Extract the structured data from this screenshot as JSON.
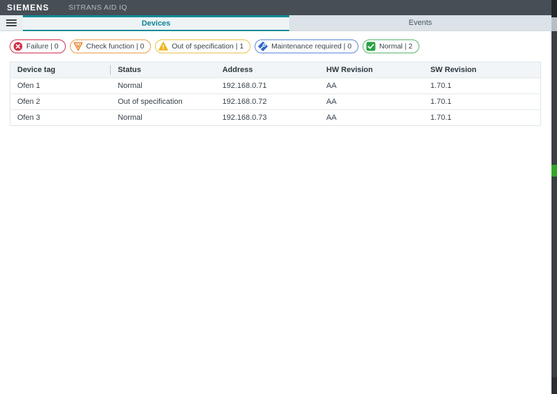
{
  "header": {
    "brand": "SIEMENS",
    "app_title": "SITRANS AID IQ"
  },
  "tabs": {
    "devices": "Devices",
    "events": "Events",
    "active": "Devices"
  },
  "filters": {
    "failure": {
      "label": "Failure | 0",
      "count": 0,
      "icon": "failure-icon",
      "color": "#d12e45"
    },
    "checkfn": {
      "label": "Check function | 0",
      "count": 0,
      "icon": "check-function-icon",
      "color": "#e87a1c"
    },
    "outofspec": {
      "label": "Out of specification | 1",
      "count": 1,
      "icon": "out-of-specification-icon",
      "color": "#edb41e"
    },
    "maintenance": {
      "label": "Maintenance required | 0",
      "count": 0,
      "icon": "maintenance-required-icon",
      "color": "#2e66c8"
    },
    "normal": {
      "label": "Normal | 2",
      "count": 2,
      "icon": "normal-icon",
      "color": "#27a343"
    }
  },
  "table": {
    "columns": [
      "Device tag",
      "Status",
      "Address",
      "HW Revision",
      "SW Revision"
    ],
    "rows": [
      [
        "Ofen 1",
        "Normal",
        "192.168.0.71",
        "AA",
        "1.70.1"
      ],
      [
        "Ofen 2",
        "Out of specification",
        "192.168.0.72",
        "AA",
        "1.70.1"
      ],
      [
        "Ofen 3",
        "Normal",
        "192.168.0.73",
        "AA",
        "1.70.1"
      ]
    ]
  },
  "colors": {
    "header_bg": "#474e55",
    "accent_teal": "#0a8a97",
    "active_tab_bg": "#eef3f5",
    "inactive_tab_bg": "#dbe3e8",
    "table_header_bg": "#f1f5f8",
    "scroll_marker_green": "#35a52a"
  }
}
